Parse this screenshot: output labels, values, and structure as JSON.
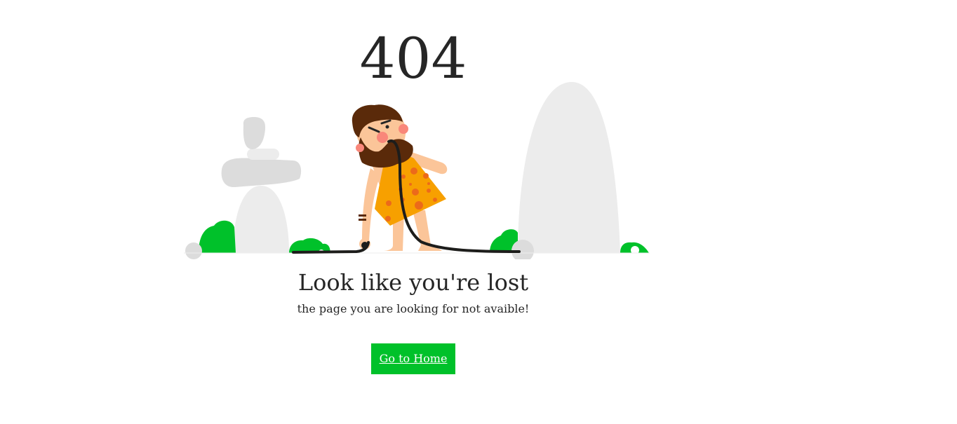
{
  "error": {
    "code": "404",
    "headline": "Look like you're lost",
    "message": "the page you are looking for not avaible!"
  },
  "actions": {
    "home_label": "Go to Home"
  },
  "colors": {
    "accent": "#00c12a",
    "text": "#262626",
    "rock": "#ececec",
    "rock_dark": "#dcdcdc",
    "skin": "#fbc599",
    "hair": "#5a2a0a",
    "tunic": "#f7a000",
    "tunic_spot": "#ec6a1a",
    "cable": "#1d1d1b"
  },
  "illustration": {
    "name": "caveman-with-cable"
  }
}
